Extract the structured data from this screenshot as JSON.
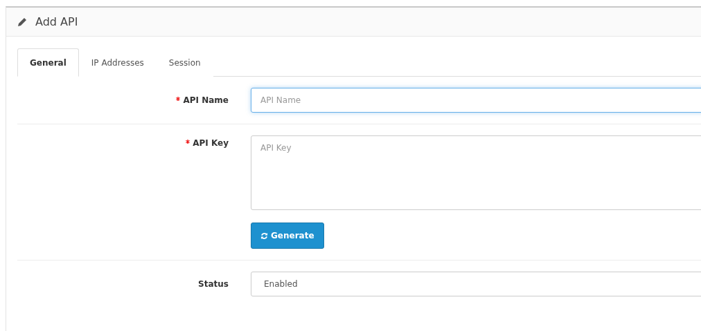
{
  "panel": {
    "title": "Add API"
  },
  "tabs": [
    {
      "label": "General",
      "selected": true
    },
    {
      "label": "IP Addresses",
      "selected": false
    },
    {
      "label": "Session",
      "selected": false
    }
  ],
  "form": {
    "rows": [
      {
        "kind": "input",
        "label": "API Name",
        "required": true,
        "placeholder": "API Name",
        "focused": true
      },
      {
        "kind": "textarea",
        "label": "API Key",
        "required": true,
        "placeholder": "API Key",
        "focused": false,
        "button": "Generate"
      },
      {
        "kind": "select",
        "label": "Status",
        "required": false,
        "value": "Enabled",
        "focused": false
      }
    ]
  }
}
